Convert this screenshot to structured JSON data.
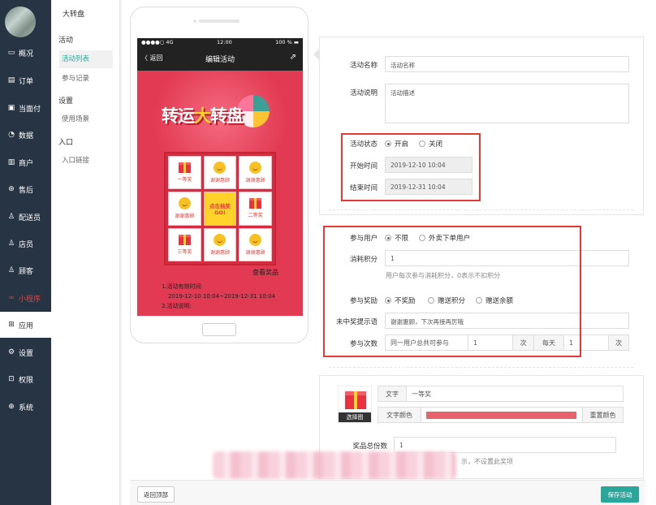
{
  "sidebar": {
    "items": [
      {
        "label": "概况",
        "icon": "monitor-icon",
        "glyph": "▭"
      },
      {
        "label": "订单",
        "icon": "order-icon",
        "glyph": "▤"
      },
      {
        "label": "当面付",
        "icon": "pay-icon",
        "glyph": "▣"
      },
      {
        "label": "数据",
        "icon": "data-icon",
        "glyph": "◔"
      },
      {
        "label": "商户",
        "icon": "shop-icon",
        "glyph": "▥"
      },
      {
        "label": "售后",
        "icon": "after-sale-icon",
        "glyph": "⊛"
      },
      {
        "label": "配送员",
        "icon": "courier-icon",
        "glyph": "♙"
      },
      {
        "label": "店员",
        "icon": "clerk-icon",
        "glyph": "♙"
      },
      {
        "label": "顾客",
        "icon": "customer-icon",
        "glyph": "♙"
      },
      {
        "label": "小程序",
        "icon": "miniapp-icon",
        "glyph": "∞"
      },
      {
        "label": "应用",
        "icon": "apps-icon",
        "glyph": "⊞"
      },
      {
        "label": "设置",
        "icon": "settings-icon",
        "glyph": "⚙"
      },
      {
        "label": "权限",
        "icon": "lock-icon",
        "glyph": "⊡"
      },
      {
        "label": "系统",
        "icon": "system-icon",
        "glyph": "⊕"
      }
    ]
  },
  "submenu": {
    "title": "大转盘",
    "group1": "活动",
    "list": "活动列表",
    "records": "参与记录",
    "group2": "设置",
    "scenes": "使用场景",
    "group3": "入口",
    "entry_link": "入口链接"
  },
  "phone": {
    "signal": "●●●●○ 4G",
    "time": "12:00",
    "battery": "100 % ▬",
    "back": "〈 返回",
    "title": "编辑活动",
    "banner_a": "转运",
    "banner_b": "大",
    "banner_c": "转盘",
    "cells": [
      "一等奖",
      "谢谢惠顾",
      "谢谢惠顾",
      "谢谢惠顾",
      "点击抽奖\nGO!",
      "二等奖",
      "三等奖",
      "谢谢惠顾",
      "谢谢惠顾"
    ],
    "view_prizes": "查看奖品",
    "rule1": "1.活动有效时间:",
    "rule1_time": "2019-12-10 10:04~2019-12-31 10:04",
    "rule2": "2.活动说明:"
  },
  "form": {
    "name_label": "活动名称",
    "name_placeholder": "活动名称",
    "desc_label": "活动说明",
    "desc_placeholder": "活动描述",
    "status_label": "活动状态",
    "status_on": "开启",
    "status_off": "关闭",
    "start_label": "开始时间",
    "start_value": "2019-12-10 10:04",
    "end_label": "结束时间",
    "end_value": "2019-12-31 10:04",
    "user_label": "参与用户",
    "user_any": "不限",
    "user_takeout": "外卖下单用户",
    "points_label": "消耗积分",
    "points_value": "1",
    "points_help": "用户每次参与消耗积分，0表示不扣积分",
    "reward_label": "参与奖励",
    "reward_none": "不奖励",
    "reward_points": "赠送积分",
    "reward_balance": "赠送余额",
    "miss_label": "未中奖提示语",
    "miss_value": "谢谢惠顾，下次再接再厉哦",
    "times_label": "参与次数",
    "times_prefix": "同一用户总共可参与",
    "times_total": "1",
    "times_unit": "次",
    "times_daily": "每天",
    "times_daily_value": "1",
    "times_unit2": "次"
  },
  "prize": {
    "choose_image": "选择图",
    "text_label": "文字",
    "text_value": "一等奖",
    "color_label": "文字颜色",
    "reset_color": "重置颜色",
    "total_label": "奖品总份数",
    "total_value": "1",
    "help_tail": "示，不设置此奖项"
  },
  "footer": {
    "back_top": "返回顶部",
    "save": "保存活动"
  },
  "colors": {
    "sidebar": "#273444",
    "accent": "#2aa79b",
    "highlight": "#e53935",
    "prize_color": "#e8626d"
  }
}
